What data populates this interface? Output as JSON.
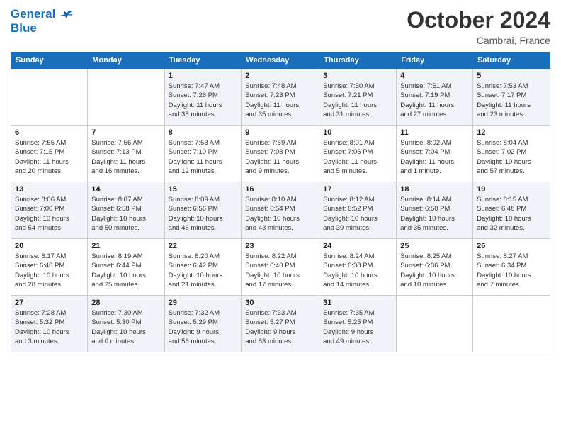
{
  "header": {
    "logo_line1": "General",
    "logo_line2": "Blue",
    "month": "October 2024",
    "location": "Cambrai, France"
  },
  "days_of_week": [
    "Sunday",
    "Monday",
    "Tuesday",
    "Wednesday",
    "Thursday",
    "Friday",
    "Saturday"
  ],
  "weeks": [
    [
      {
        "day": "",
        "info": ""
      },
      {
        "day": "",
        "info": ""
      },
      {
        "day": "1",
        "info": "Sunrise: 7:47 AM\nSunset: 7:26 PM\nDaylight: 11 hours\nand 38 minutes."
      },
      {
        "day": "2",
        "info": "Sunrise: 7:48 AM\nSunset: 7:23 PM\nDaylight: 11 hours\nand 35 minutes."
      },
      {
        "day": "3",
        "info": "Sunrise: 7:50 AM\nSunset: 7:21 PM\nDaylight: 11 hours\nand 31 minutes."
      },
      {
        "day": "4",
        "info": "Sunrise: 7:51 AM\nSunset: 7:19 PM\nDaylight: 11 hours\nand 27 minutes."
      },
      {
        "day": "5",
        "info": "Sunrise: 7:53 AM\nSunset: 7:17 PM\nDaylight: 11 hours\nand 23 minutes."
      }
    ],
    [
      {
        "day": "6",
        "info": "Sunrise: 7:55 AM\nSunset: 7:15 PM\nDaylight: 11 hours\nand 20 minutes."
      },
      {
        "day": "7",
        "info": "Sunrise: 7:56 AM\nSunset: 7:13 PM\nDaylight: 11 hours\nand 16 minutes."
      },
      {
        "day": "8",
        "info": "Sunrise: 7:58 AM\nSunset: 7:10 PM\nDaylight: 11 hours\nand 12 minutes."
      },
      {
        "day": "9",
        "info": "Sunrise: 7:59 AM\nSunset: 7:08 PM\nDaylight: 11 hours\nand 9 minutes."
      },
      {
        "day": "10",
        "info": "Sunrise: 8:01 AM\nSunset: 7:06 PM\nDaylight: 11 hours\nand 5 minutes."
      },
      {
        "day": "11",
        "info": "Sunrise: 8:02 AM\nSunset: 7:04 PM\nDaylight: 11 hours\nand 1 minute."
      },
      {
        "day": "12",
        "info": "Sunrise: 8:04 AM\nSunset: 7:02 PM\nDaylight: 10 hours\nand 57 minutes."
      }
    ],
    [
      {
        "day": "13",
        "info": "Sunrise: 8:06 AM\nSunset: 7:00 PM\nDaylight: 10 hours\nand 54 minutes."
      },
      {
        "day": "14",
        "info": "Sunrise: 8:07 AM\nSunset: 6:58 PM\nDaylight: 10 hours\nand 50 minutes."
      },
      {
        "day": "15",
        "info": "Sunrise: 8:09 AM\nSunset: 6:56 PM\nDaylight: 10 hours\nand 46 minutes."
      },
      {
        "day": "16",
        "info": "Sunrise: 8:10 AM\nSunset: 6:54 PM\nDaylight: 10 hours\nand 43 minutes."
      },
      {
        "day": "17",
        "info": "Sunrise: 8:12 AM\nSunset: 6:52 PM\nDaylight: 10 hours\nand 39 minutes."
      },
      {
        "day": "18",
        "info": "Sunrise: 8:14 AM\nSunset: 6:50 PM\nDaylight: 10 hours\nand 35 minutes."
      },
      {
        "day": "19",
        "info": "Sunrise: 8:15 AM\nSunset: 6:48 PM\nDaylight: 10 hours\nand 32 minutes."
      }
    ],
    [
      {
        "day": "20",
        "info": "Sunrise: 8:17 AM\nSunset: 6:46 PM\nDaylight: 10 hours\nand 28 minutes."
      },
      {
        "day": "21",
        "info": "Sunrise: 8:19 AM\nSunset: 6:44 PM\nDaylight: 10 hours\nand 25 minutes."
      },
      {
        "day": "22",
        "info": "Sunrise: 8:20 AM\nSunset: 6:42 PM\nDaylight: 10 hours\nand 21 minutes."
      },
      {
        "day": "23",
        "info": "Sunrise: 8:22 AM\nSunset: 6:40 PM\nDaylight: 10 hours\nand 17 minutes."
      },
      {
        "day": "24",
        "info": "Sunrise: 8:24 AM\nSunset: 6:38 PM\nDaylight: 10 hours\nand 14 minutes."
      },
      {
        "day": "25",
        "info": "Sunrise: 8:25 AM\nSunset: 6:36 PM\nDaylight: 10 hours\nand 10 minutes."
      },
      {
        "day": "26",
        "info": "Sunrise: 8:27 AM\nSunset: 6:34 PM\nDaylight: 10 hours\nand 7 minutes."
      }
    ],
    [
      {
        "day": "27",
        "info": "Sunrise: 7:28 AM\nSunset: 5:32 PM\nDaylight: 10 hours\nand 3 minutes."
      },
      {
        "day": "28",
        "info": "Sunrise: 7:30 AM\nSunset: 5:30 PM\nDaylight: 10 hours\nand 0 minutes."
      },
      {
        "day": "29",
        "info": "Sunrise: 7:32 AM\nSunset: 5:29 PM\nDaylight: 9 hours\nand 56 minutes."
      },
      {
        "day": "30",
        "info": "Sunrise: 7:33 AM\nSunset: 5:27 PM\nDaylight: 9 hours\nand 53 minutes."
      },
      {
        "day": "31",
        "info": "Sunrise: 7:35 AM\nSunset: 5:25 PM\nDaylight: 9 hours\nand 49 minutes."
      },
      {
        "day": "",
        "info": ""
      },
      {
        "day": "",
        "info": ""
      }
    ]
  ]
}
